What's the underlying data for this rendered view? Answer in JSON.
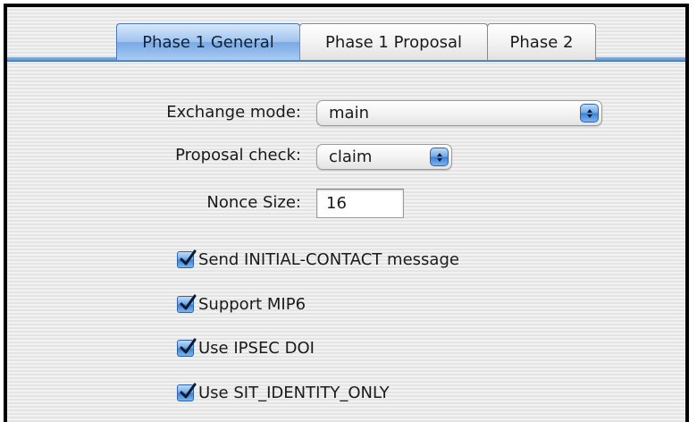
{
  "tabs": [
    {
      "label": "Phase 1 General",
      "active": true
    },
    {
      "label": "Phase 1 Proposal",
      "active": false
    },
    {
      "label": "Phase 2",
      "active": false
    }
  ],
  "exchange_mode": {
    "label": "Exchange mode:",
    "value": "main"
  },
  "proposal_check": {
    "label": "Proposal check:",
    "value": "claim"
  },
  "nonce_size": {
    "label": "Nonce Size:",
    "value": "16"
  },
  "checkboxes": [
    {
      "label": "Send INITIAL-CONTACT message",
      "checked": true
    },
    {
      "label": "Support MIP6",
      "checked": true
    },
    {
      "label": "Use IPSEC DOI",
      "checked": true
    },
    {
      "label": "Use SIT_IDENTITY_ONLY",
      "checked": true
    }
  ],
  "icons": {
    "popup_arrows": "up-down-arrows-icon",
    "checkmark": "checkmark-icon"
  },
  "colors": {
    "accent": "#5f8fcb",
    "active_tab": "#9fc3ee",
    "background_stripe_light": "#f2f2f2",
    "background_stripe_dark": "#e4e4e4"
  }
}
